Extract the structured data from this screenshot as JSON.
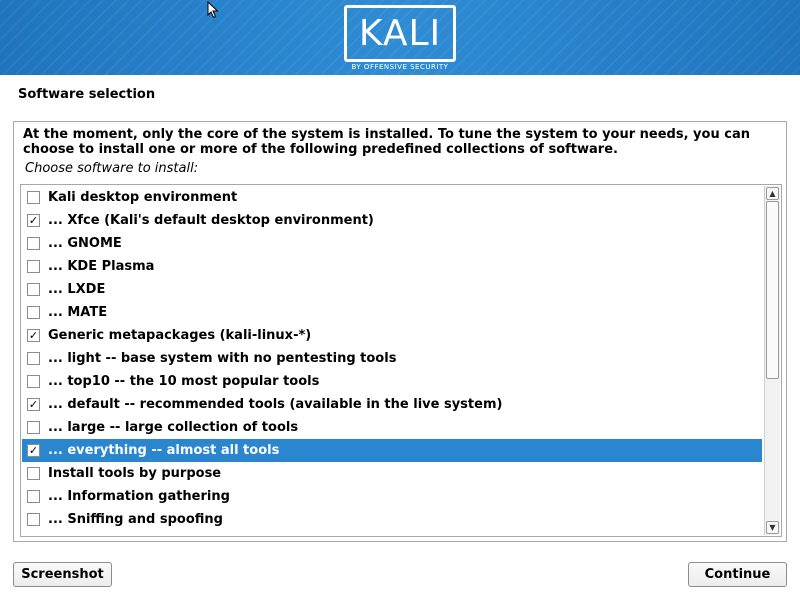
{
  "header": {
    "logo_text": "KALI",
    "logo_subtitle": "BY OFFENSIVE SECURITY"
  },
  "page": {
    "title": "Software selection",
    "description": "At the moment, only the core of the system is installed. To tune the system to your needs, you can choose to install one or more of the following predefined collections of software.",
    "prompt": "Choose software to install:"
  },
  "software_list": {
    "items": [
      {
        "label": "Kali desktop environment",
        "checked": false,
        "selected": false
      },
      {
        "label": "... Xfce (Kali's default desktop environment)",
        "checked": true,
        "selected": false
      },
      {
        "label": "... GNOME",
        "checked": false,
        "selected": false
      },
      {
        "label": "... KDE Plasma",
        "checked": false,
        "selected": false
      },
      {
        "label": "... LXDE",
        "checked": false,
        "selected": false
      },
      {
        "label": "... MATE",
        "checked": false,
        "selected": false
      },
      {
        "label": "Generic metapackages (kali-linux-*)",
        "checked": true,
        "selected": false
      },
      {
        "label": "... light -- base system with no pentesting tools",
        "checked": false,
        "selected": false
      },
      {
        "label": "... top10 -- the 10 most popular tools",
        "checked": false,
        "selected": false
      },
      {
        "label": "... default -- recommended tools (available in the live system)",
        "checked": true,
        "selected": false
      },
      {
        "label": "... large -- large collection of tools",
        "checked": false,
        "selected": false
      },
      {
        "label": "... everything -- almost all tools",
        "checked": true,
        "selected": true
      },
      {
        "label": "Install tools by purpose",
        "checked": false,
        "selected": false
      },
      {
        "label": "... Information gathering",
        "checked": false,
        "selected": false
      },
      {
        "label": "... Sniffing and spoofing",
        "checked": false,
        "selected": false
      }
    ],
    "check_glyph": "✓",
    "scroll_up_glyph": "▲",
    "scroll_down_glyph": "▼"
  },
  "footer": {
    "screenshot_label": "Screenshot",
    "continue_label": "Continue"
  },
  "icons": {
    "cursor": "mouse-pointer-icon",
    "checkbox": "checkbox-icon",
    "scroll_up": "scroll-up-arrow-icon",
    "scroll_down": "scroll-down-arrow-icon"
  },
  "colors": {
    "banner_blue": "#2a86cf",
    "selection_blue": "#2a86cf",
    "border_gray": "#a8a8a8"
  }
}
